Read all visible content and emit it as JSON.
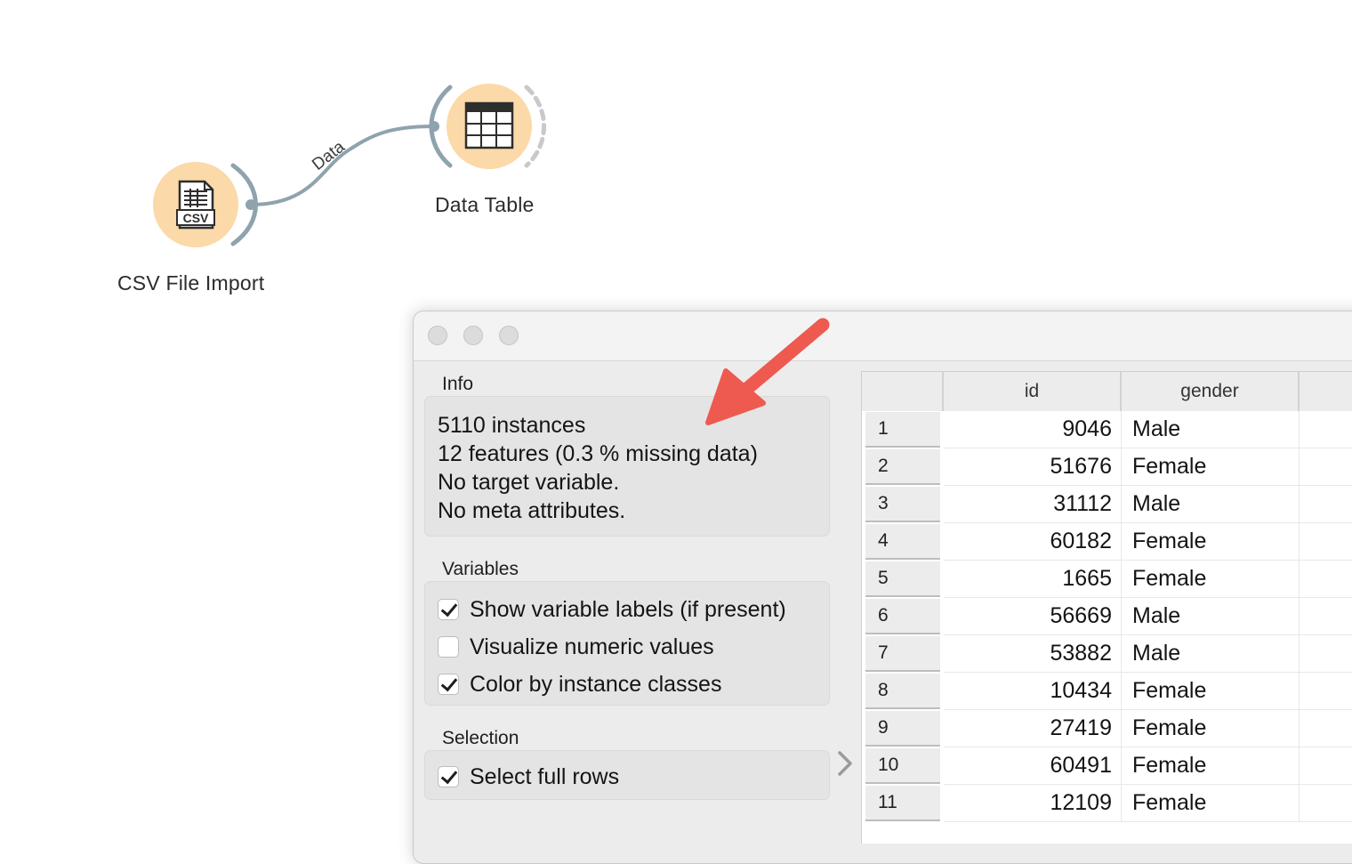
{
  "canvas": {
    "nodes": [
      {
        "label": "CSV File Import",
        "icon": "csv-file-icon",
        "icon_text": "CSV"
      },
      {
        "label": "Data Table",
        "icon": "data-table-icon"
      }
    ],
    "link_label": "Data",
    "node_color": "#fbd9a8",
    "link_color": "#8ea3ad"
  },
  "window": {
    "info": {
      "title": "Info",
      "lines": [
        "5110 instances",
        "12  features (0.3 % missing data)",
        "No target variable.",
        "No meta attributes."
      ]
    },
    "variables": {
      "title": "Variables",
      "options": [
        {
          "label": "Show variable labels (if present)",
          "checked": true
        },
        {
          "label": "Visualize numeric values",
          "checked": false
        },
        {
          "label": "Color by instance classes",
          "checked": true
        }
      ]
    },
    "selection": {
      "title": "Selection",
      "options": [
        {
          "label": "Select full rows",
          "checked": true
        }
      ]
    },
    "table": {
      "columns": [
        "id",
        "gender"
      ],
      "rows": [
        {
          "n": "1",
          "id": "9046",
          "gender": "Male"
        },
        {
          "n": "2",
          "id": "51676",
          "gender": "Female"
        },
        {
          "n": "3",
          "id": "31112",
          "gender": "Male"
        },
        {
          "n": "4",
          "id": "60182",
          "gender": "Female"
        },
        {
          "n": "5",
          "id": "1665",
          "gender": "Female"
        },
        {
          "n": "6",
          "id": "56669",
          "gender": "Male"
        },
        {
          "n": "7",
          "id": "53882",
          "gender": "Male"
        },
        {
          "n": "8",
          "id": "10434",
          "gender": "Female"
        },
        {
          "n": "9",
          "id": "27419",
          "gender": "Female"
        },
        {
          "n": "10",
          "id": "60491",
          "gender": "Female"
        },
        {
          "n": "11",
          "id": "12109",
          "gender": "Female"
        }
      ]
    }
  },
  "annotation": {
    "arrow_color": "#ee5a4f"
  }
}
